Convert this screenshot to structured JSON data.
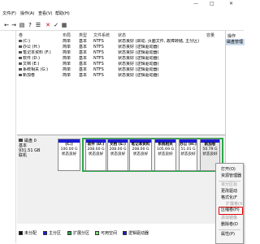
{
  "menubar": [
    "文件(F)",
    "操作(A)",
    "查看(V)",
    "帮助(H)"
  ],
  "window_controls": [
    "—",
    "□",
    "✕"
  ],
  "volume_list": {
    "headers": [
      "卷",
      "布局",
      "类型",
      "文件系统",
      "状态",
      "容量"
    ],
    "rows": [
      {
        "vol": "(C:)",
        "layout": "简单",
        "type": "基本",
        "fs": "NTFS",
        "status": "状态良好 (启动, 页面文件, 故障转储, 主分区)"
      },
      {
        "vol": "办公 (H:)",
        "layout": "简单",
        "type": "基本",
        "fs": "NTFS",
        "status": "状态良好 (逻辑驱动器)"
      },
      {
        "vol": "笔记本资料 (F:)",
        "layout": "简单",
        "type": "基本",
        "fs": "NTFS",
        "status": "状态良好 (逻辑驱动器)"
      },
      {
        "vol": "软件 (D:)",
        "layout": "简单",
        "type": "基本",
        "fs": "NTFS",
        "status": "状态良好 (逻辑驱动器)"
      },
      {
        "vol": "文档 (E:)",
        "layout": "简单",
        "type": "基本",
        "fs": "NTFS",
        "status": "状态良好 (逻辑驱动器)"
      },
      {
        "vol": "系统相关 (G:)",
        "layout": "简单",
        "type": "基本",
        "fs": "NTFS",
        "status": "状态良好 (逻辑驱动器)"
      },
      {
        "vol": "新加卷",
        "layout": "简单",
        "type": "基本",
        "fs": "NTFS",
        "status": "状态良好 (逻辑驱动器)"
      }
    ]
  },
  "operations": {
    "title": "操作",
    "item": "磁盘管理"
  },
  "disk": {
    "name": "磁盘 0",
    "type": "基本",
    "size": "931.51 GB",
    "status": "联机"
  },
  "partitions": [
    {
      "name": "(C:)",
      "size": "100.00 G",
      "status": "状态良好"
    },
    {
      "name": "软件 (D:)",
      "size": "208.00 G",
      "status": "状态良好"
    },
    {
      "name": "文档 (E:)",
      "size": "208.00 G",
      "status": "状态良好"
    },
    {
      "name": "笔记本资料",
      "size": "208.00 G",
      "status": "状态良好"
    },
    {
      "name": "系统相关",
      "size": "105.69 G",
      "status": "状态良好"
    },
    {
      "name": "办公 (H:)",
      "size": "51.01 G",
      "status": "状态良好"
    },
    {
      "name": "新加卷",
      "size": "50.79 G",
      "status": "状态良好"
    }
  ],
  "legend": [
    {
      "label": "未分配",
      "color": "#111111"
    },
    {
      "label": "主分区",
      "color": "#1b1bd6"
    },
    {
      "label": "扩展分区",
      "color": "#2ba84a"
    },
    {
      "label": "可用空间",
      "color": "#7ee07e"
    },
    {
      "label": "逻辑驱动器",
      "color": "#1b1bd6"
    }
  ],
  "context_menu": {
    "open": "打开(O)",
    "explorer": "资源管理器",
    "mark_active": "将分区标",
    "change_letter": "更改驱动",
    "format": "格式化(F",
    "extend": "扩展卷(X",
    "shrink": "压缩卷(H)",
    "add_mirror": "添加镜像",
    "delete": "删除卷(D",
    "properties": "属性(P)"
  }
}
